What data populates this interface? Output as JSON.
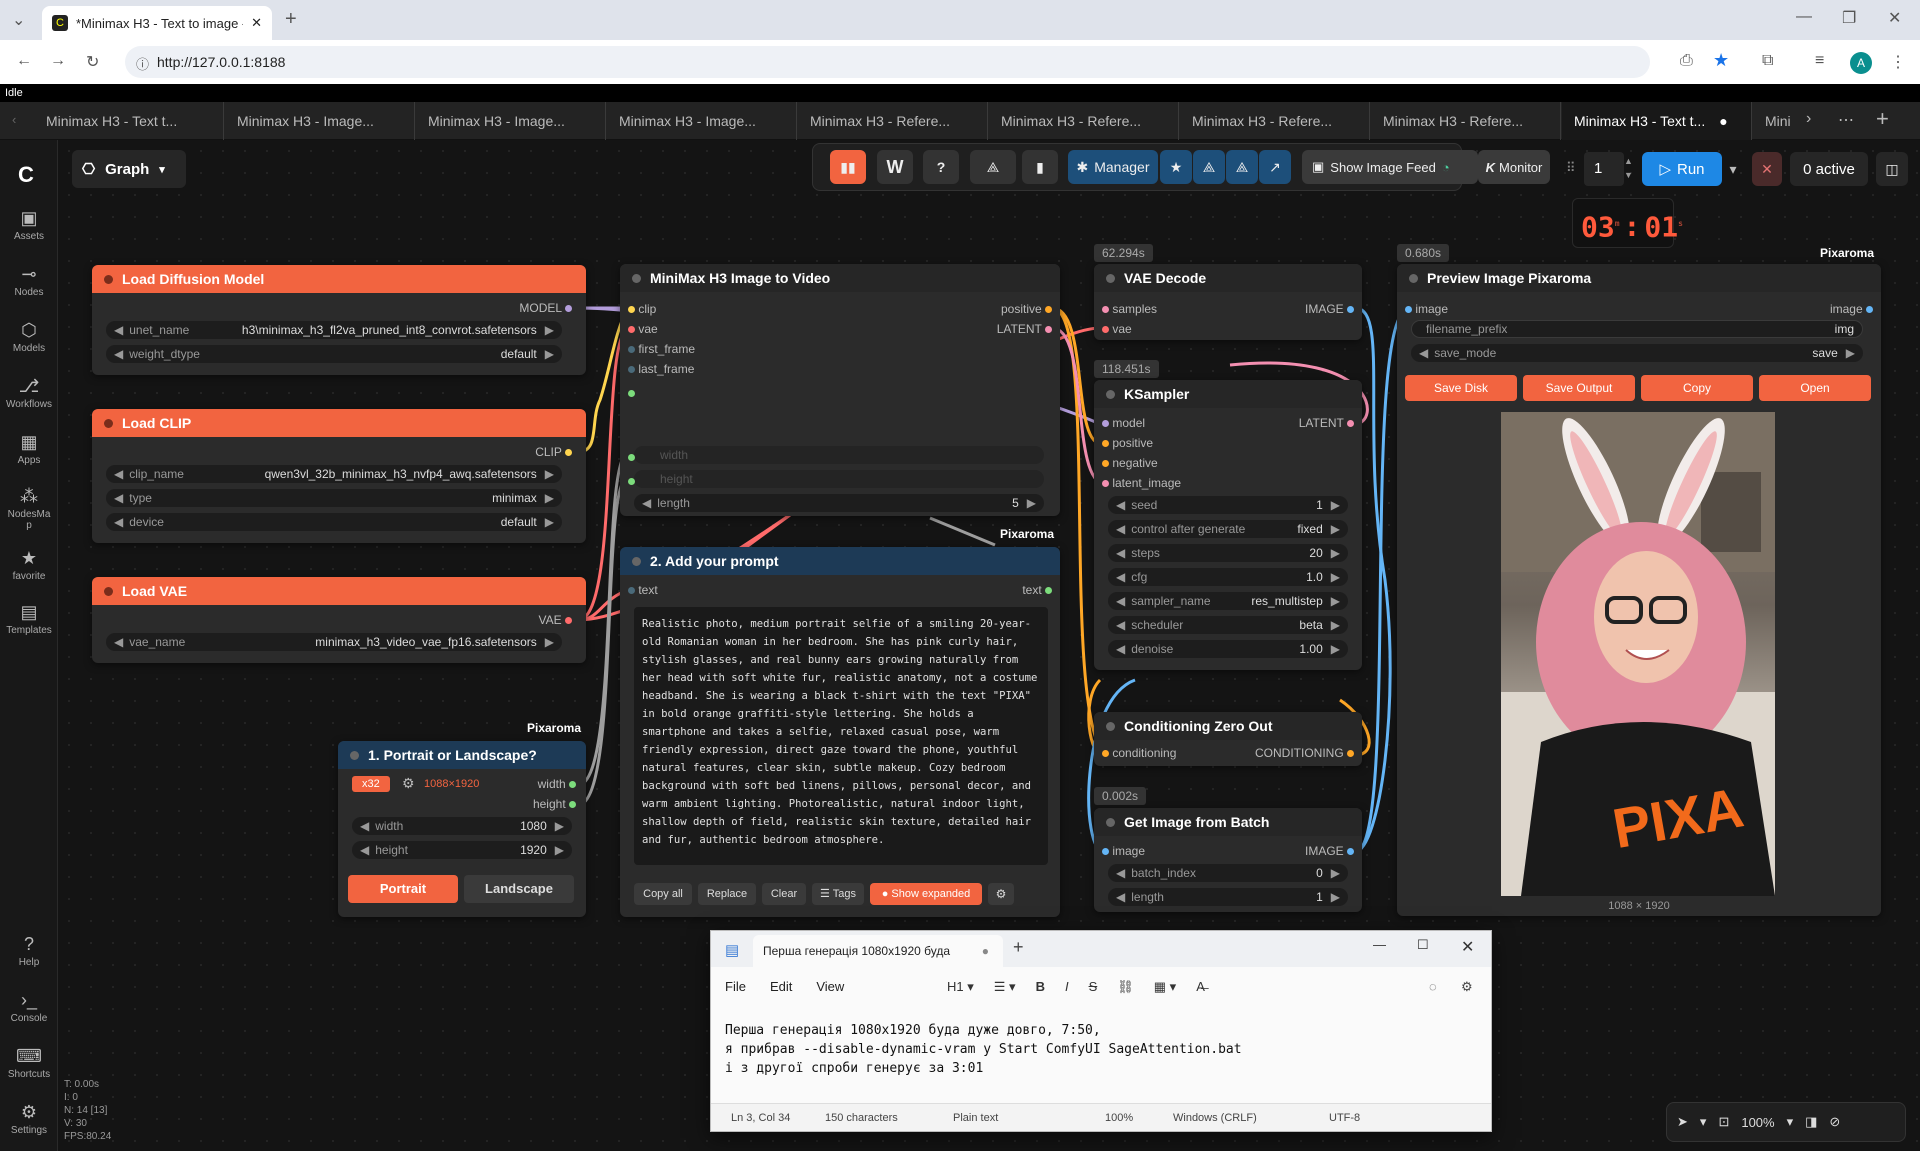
{
  "browser": {
    "tab_title": "*Minimax H3 - Text to image - C",
    "url": "http://127.0.0.1:8188",
    "profile": "A"
  },
  "status": "Idle",
  "workflow_tabs": [
    "Minimax H3 - Text t...",
    "Minimax H3 - Image...",
    "Minimax H3 - Image...",
    "Minimax H3 - Image...",
    "Minimax H3 - Refere...",
    "Minimax H3 - Refere...",
    "Minimax H3 - Refere...",
    "Minimax H3 - Refere...",
    "Minimax H3 - Text t...",
    "Mini"
  ],
  "sidebar": [
    "Assets",
    "Nodes",
    "Models",
    "Workflows",
    "Apps",
    "NodesMap",
    "favorite",
    "Templates",
    "Help",
    "Console",
    "Shortcuts",
    "Settings"
  ],
  "graph_label": "Graph",
  "toolbar": {
    "manager": "Manager",
    "feed": "Show Image Feed",
    "monitor": "Monitor",
    "count": "1",
    "run": "Run",
    "active": "0 active"
  },
  "timer": {
    "min": "03",
    "sec": "01",
    "m": "m",
    "s": "s"
  },
  "stats": {
    "t": "T: 0.00s",
    "i": "I: 0",
    "n": "N: 14 [13]",
    "v": "V: 30",
    "fps": "FPS:80.24"
  },
  "load_diffusion": {
    "title": "Load Diffusion Model",
    "out": "MODEL",
    "unet_label": "unet_name",
    "unet": "h3\\minimax_h3_fl2va_pruned_int8_convrot.safetensors",
    "dtype_label": "weight_dtype",
    "dtype": "default"
  },
  "load_clip": {
    "title": "Load CLIP",
    "out": "CLIP",
    "name_label": "clip_name",
    "name": "qwen3vl_32b_minimax_h3_nvfp4_awq.safetensors",
    "type_label": "type",
    "type": "minimax",
    "device_label": "device",
    "device": "default"
  },
  "load_vae": {
    "title": "Load VAE",
    "out": "VAE",
    "name_label": "vae_name",
    "name": "minimax_h3_video_vae_fp16.safetensors"
  },
  "i2v": {
    "title": "MiniMax H3 Image to Video",
    "in": [
      "clip",
      "vae",
      "first_frame",
      "last_frame"
    ],
    "out_pos": "positive",
    "out_lat": "LATENT",
    "width": "width",
    "height": "height",
    "length_label": "length",
    "length": "5"
  },
  "pixaroma": "Pixaroma",
  "prompt_node": {
    "title": "2. Add your prompt",
    "in": "text",
    "out": "text",
    "text": "Realistic photo, medium portrait selfie of a smiling 20-year-old Romanian woman in her bedroom. She has pink curly hair, stylish glasses, and real bunny ears growing naturally from her head with soft white fur, realistic anatomy, not a costume headband. She is wearing a black t-shirt with the text \"PIXA\" in bold orange graffiti-style lettering. She holds a smartphone and takes a selfie, relaxed casual pose, warm friendly expression, direct gaze toward the phone, youthful natural features, clear skin, subtle makeup. Cozy bedroom background with soft bed linens, pillows, personal decor, and warm ambient lighting. Photorealistic, natural indoor light, shallow depth of field, realistic skin texture, detailed hair and fur, authentic bedroom atmosphere.",
    "buttons": [
      "Copy all",
      "Replace",
      "Clear",
      "☰ Tags",
      "Show expanded"
    ]
  },
  "portrait": {
    "title": "1. Portrait or Landscape?",
    "badge": "x32",
    "res": "1088×1920",
    "out_w": "width",
    "out_h": "height",
    "w_label": "width",
    "w": "1080",
    "h_label": "height",
    "h": "1920",
    "btn_p": "Portrait",
    "btn_l": "Landscape"
  },
  "vae_decode": {
    "time": "62.294s",
    "title": "VAE Decode",
    "in": [
      "samples",
      "vae"
    ],
    "out": "IMAGE"
  },
  "ksampler": {
    "time": "118.451s",
    "title": "KSampler",
    "in": [
      "model",
      "positive",
      "negative",
      "latent_image"
    ],
    "out": "LATENT",
    "widgets": [
      [
        "seed",
        "1"
      ],
      [
        "control after generate",
        "fixed"
      ],
      [
        "steps",
        "20"
      ],
      [
        "cfg",
        "1.0"
      ],
      [
        "sampler_name",
        "res_multistep"
      ],
      [
        "scheduler",
        "beta"
      ],
      [
        "denoise",
        "1.00"
      ]
    ]
  },
  "czo": {
    "title": "Conditioning Zero Out",
    "in": "conditioning",
    "out": "CONDITIONING"
  },
  "batch": {
    "time": "0.002s",
    "title": "Get Image from Batch",
    "in": "image",
    "out": "IMAGE",
    "idx_label": "batch_index",
    "idx": "0",
    "len_label": "length",
    "len": "1"
  },
  "preview": {
    "time": "0.680s",
    "title": "Preview Image Pixaroma",
    "in": "image",
    "out": "image",
    "prefix_label": "filename_prefix",
    "prefix": "img",
    "mode_label": "save_mode",
    "mode": "save",
    "buttons": [
      "Save Disk",
      "Save Output",
      "Copy",
      "Open"
    ],
    "size": "1088 × 1920",
    "shirt_text": "PIXA"
  },
  "notepad": {
    "tab": "Перша генерація 1080x1920 буда",
    "menu": [
      "File",
      "Edit",
      "View"
    ],
    "heading": "H1",
    "lines": [
      "Перша генерація 1080x1920 буда дуже довго, 7:50,",
      "я прибрав --disable-dynamic-vram  у Start ComfyUI SageAttention.bat",
      "і з другої спроби генерує за 3:01"
    ],
    "status": [
      "Ln 3, Col 34",
      "150 characters",
      "Plain text",
      "100%",
      "Windows (CRLF)",
      "UTF-8"
    ]
  },
  "zoom": "100%",
  "colors": {
    "accent": "#f26440",
    "run": "#1e88e5",
    "manager": "#1d4f7a"
  }
}
